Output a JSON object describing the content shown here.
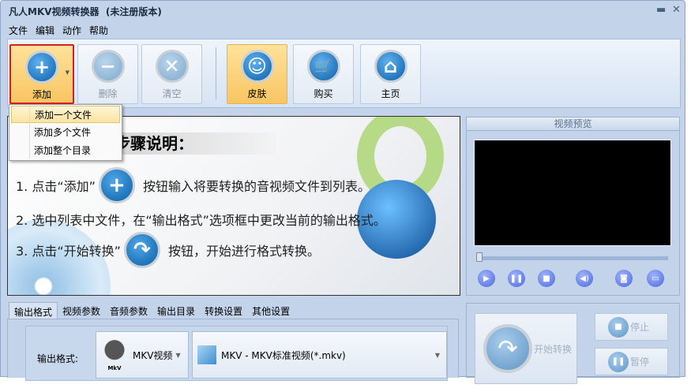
{
  "window": {
    "title": "凡人MKV视频转换器",
    "title_suffix": "(未注册版本)",
    "minimize": "▬",
    "close": "✕"
  },
  "menu": [
    "文件",
    "编辑",
    "动作",
    "帮助"
  ],
  "toolbar": {
    "add": "添加",
    "delete": "删除",
    "clear": "清空",
    "skin": "皮肤",
    "buy": "购买",
    "home": "主页"
  },
  "add_menu": [
    "添加一个文件",
    "添加多个文件",
    "添加整个目录"
  ],
  "guide": {
    "heading": "步骤说明：",
    "step1_a": "1. 点击“添加”",
    "step1_b": "按钮输入将要转换的音视频文件到列表。",
    "step2": "2. 选中列表中文件，在“输出格式”选项框中更改当前的输出格式。",
    "step3_a": "3. 点击“开始转换”",
    "step3_b": "按钮，开始进行格式转换。"
  },
  "preview": {
    "title": "视频预览",
    "position": 0
  },
  "tabs": [
    "输出格式",
    "视频参数",
    "音频参数",
    "输出目录",
    "转换设置",
    "其他设置"
  ],
  "output": {
    "label": "输出格式:",
    "category": "MKV视频",
    "category_icon_text": "MkV",
    "format": "MKV - MKV标准视频(*.mkv)"
  },
  "actions": {
    "start": "开始转换",
    "stop": "停止",
    "pause": "暂停"
  }
}
